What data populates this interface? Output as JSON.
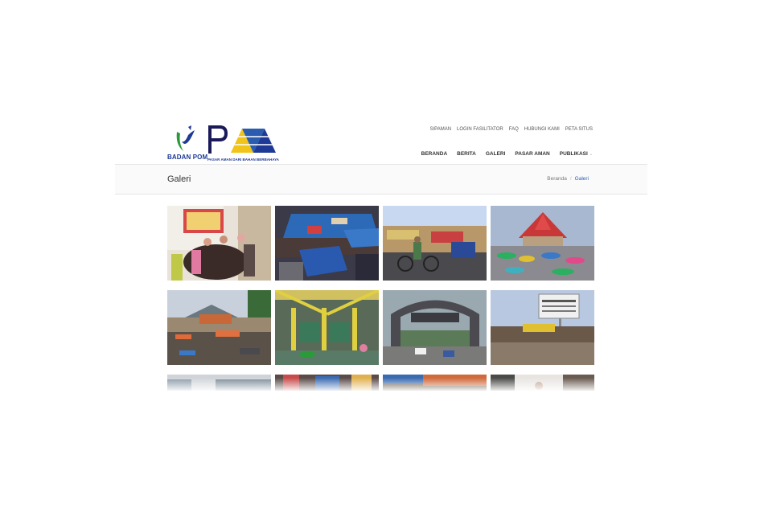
{
  "logos": {
    "bpom_text": "BADAN POM",
    "pam_tagline": "PASAR AMAN DARI BAHAN BERBAHAYA"
  },
  "top_links": [
    "SIPAMAN",
    "LOGIN FASILITATOR",
    "FAQ",
    "HUBUNGI KAMI",
    "PETA SITUS"
  ],
  "main_nav": [
    "BERANDA",
    "BERITA",
    "GALERI",
    "PASAR AMAN",
    "PUBLIKASI"
  ],
  "page_title": "Galeri",
  "breadcrumb": {
    "home": "Beranda",
    "separator": "/",
    "current": "Galeri"
  },
  "colors": {
    "brand_blue": "#1e3a96",
    "link_blue": "#2a5db0"
  },
  "gallery": {
    "photos": [
      "indoor-market-crowd",
      "market-stalls-blue-tarps",
      "street-cyclist-shops",
      "market-with-gadang-roofs",
      "mountain-view-market",
      "yellow-pavilion-market",
      "market-gate-arch",
      "market-sign-board",
      "building-facade",
      "crowd-street",
      "market-tent-awning",
      "shop-interior"
    ]
  }
}
